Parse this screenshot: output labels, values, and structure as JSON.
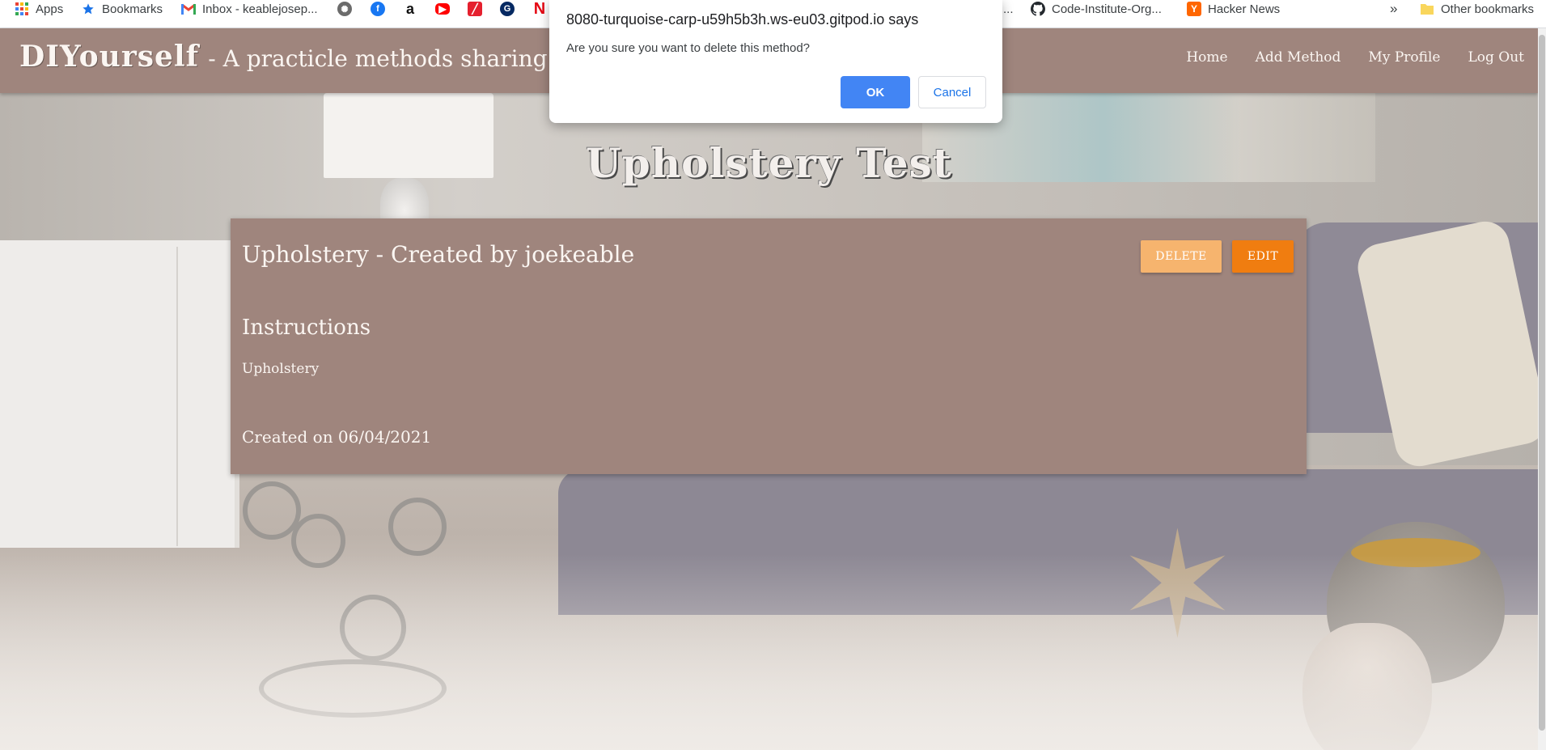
{
  "bookmarks": {
    "apps_label": "Apps",
    "bookmarks_label": "Bookmarks",
    "gmail_label": "Inbox - keablejosep...",
    "amazon_glyph": "a",
    "truncated_label": "...",
    "github_label": "Code-Institute-Org...",
    "hacker_news_label": "Hacker News",
    "hacker_news_glyph": "Y",
    "more_glyph": "»",
    "other_bookmarks_label": "Other bookmarks"
  },
  "nav": {
    "brand": "DIYourself",
    "tagline": "- A practicle methods sharing for",
    "links": [
      "Home",
      "Add Method",
      "My Profile",
      "Log Out"
    ]
  },
  "page": {
    "title": "Upholstery Test"
  },
  "card": {
    "heading": "Upholstery - Created by joekeable",
    "delete_label": "DELETE",
    "edit_label": "EDIT",
    "instructions_heading": "Instructions",
    "instructions_text": "Upholstery",
    "created": "Created on 06/04/2021"
  },
  "dialog": {
    "origin": "8080-turquoise-carp-u59h5b3h.ws-eu03.gitpod.io says",
    "message": "Are you sure you want to delete this method?",
    "ok_label": "OK",
    "cancel_label": "Cancel"
  },
  "colors": {
    "navbar": "#9f857d",
    "delete_button": "#f6b46e",
    "edit_button": "#f07d10",
    "dialog_ok": "#4285f4"
  }
}
